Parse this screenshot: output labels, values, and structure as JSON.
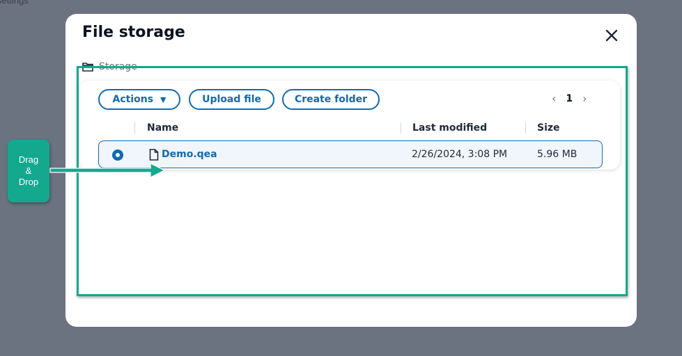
{
  "backdrop": {
    "text": "settings"
  },
  "modal": {
    "title": "File storage",
    "close_icon": "close-icon",
    "breadcrumb": {
      "icon": "folder-icon",
      "label": "Storage"
    }
  },
  "toolbar": {
    "actions_label": "Actions",
    "actions_caret": "▼",
    "upload_label": "Upload file",
    "create_folder_label": "Create folder"
  },
  "pagination": {
    "prev": "‹",
    "current": "1",
    "next": "›"
  },
  "table": {
    "columns": [
      "Name",
      "Last modified",
      "Size"
    ],
    "rows": [
      {
        "name": "Demo.qea",
        "modified": "2/26/2024, 3:08 PM",
        "size": "5.96 MB",
        "icon": "file-icon",
        "selected": true
      }
    ]
  },
  "annotation": {
    "badge_lines": [
      "Drag",
      "&",
      "Drop"
    ],
    "color": "#14a88f"
  },
  "colors": {
    "accent": "#0f6ab4",
    "overlay": "#6b7280",
    "annotation": "#14a88f"
  }
}
